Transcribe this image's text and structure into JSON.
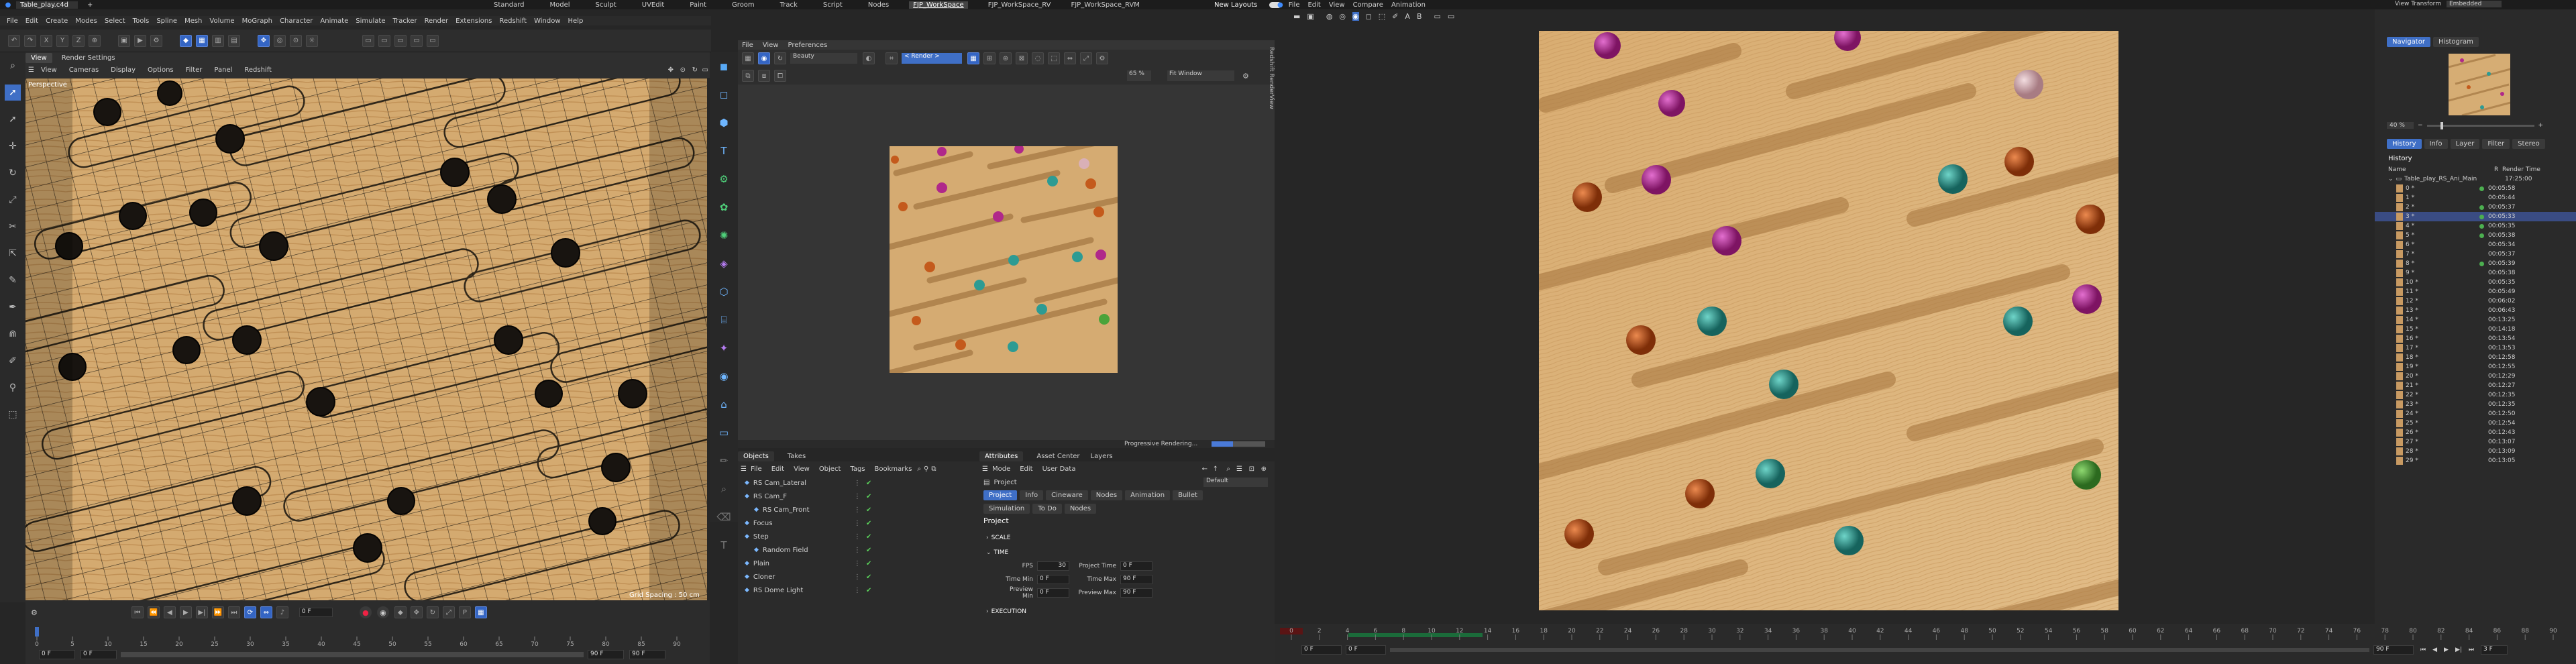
{
  "topbar": {
    "file": "Table_play.c4d",
    "layouts": [
      "Standard",
      "Model",
      "Sculpt",
      "UVEdit",
      "Paint",
      "Groom",
      "Track",
      "Script",
      "Nodes",
      "FJP_WorkSpace",
      "FJP_WorkSpace_RV",
      "FJP_WorkSpace_RVM"
    ],
    "active_layout": "FJP_WorkSpace",
    "new_layouts": "New Layouts",
    "rv_menu": [
      "File",
      "Edit",
      "View",
      "Compare",
      "Animation"
    ],
    "view_transform_label": "View Transform",
    "view_transform_value": "Embedded"
  },
  "menubar": [
    "File",
    "Edit",
    "Create",
    "Modes",
    "Select",
    "Tools",
    "Spline",
    "Mesh",
    "Volume",
    "MoGraph",
    "Character",
    "Animate",
    "Simulate",
    "Tracker",
    "Render",
    "Extensions",
    "Redshift",
    "Window",
    "Help"
  ],
  "viewport": {
    "tabs": [
      "View",
      "Render Settings"
    ],
    "menu": [
      "View",
      "Cameras",
      "Display",
      "Options",
      "Filter",
      "Panel",
      "Redshift"
    ],
    "label": "Perspective",
    "grid_spacing": "Grid Spacing : 50 cm"
  },
  "timeline": {
    "ticks": [
      "0",
      "5",
      "10",
      "15",
      "20",
      "25",
      "30",
      "35",
      "40",
      "45",
      "50",
      "55",
      "60",
      "65",
      "70",
      "75",
      "80",
      "85",
      "90"
    ],
    "current_frame": "0 F",
    "start": "0 F",
    "start2": "0 F",
    "end": "90 F",
    "end2": "90 F"
  },
  "rv": {
    "menu": [
      "File",
      "View",
      "Preferences"
    ],
    "beauty": "Beauty",
    "render_btn": "< Render >",
    "zoom": "65 %",
    "fit": "Fit Window",
    "progress_label": "Progressive Rendering...",
    "side_label": "Redshift RenderView"
  },
  "objects": {
    "tabs": [
      "Objects",
      "Takes"
    ],
    "menu": [
      "File",
      "Edit",
      "View",
      "Object",
      "Tags",
      "Bookmarks"
    ],
    "items": [
      {
        "name": "RS Cam_Lateral",
        "indent": 0
      },
      {
        "name": "RS Cam_F",
        "indent": 0
      },
      {
        "name": "RS Cam_Front",
        "indent": 1
      },
      {
        "name": "Focus",
        "indent": 0
      },
      {
        "name": "Step",
        "indent": 0
      },
      {
        "name": "Random Field",
        "indent": 1
      },
      {
        "name": "Plain",
        "indent": 0
      },
      {
        "name": "Cloner",
        "indent": 0
      },
      {
        "name": "RS Dome Light",
        "indent": 0
      }
    ]
  },
  "attributes": {
    "tabs": [
      "Attributes",
      "Asset Center",
      "Layers"
    ],
    "menu": [
      "Mode",
      "Edit",
      "User Data"
    ],
    "project_label": "Project",
    "default": "Default",
    "subtabs": [
      "Project",
      "Info",
      "Cineware",
      "Nodes",
      "Animation",
      "Bullet",
      "Simulation",
      "To Do",
      "Nodes"
    ],
    "section": "Project",
    "scale": "SCALE",
    "time": "TIME",
    "fps_label": "FPS",
    "fps": "30",
    "project_time_label": "Project Time",
    "project_time": "0 F",
    "min_time_label": "Time Min",
    "min_time": "0 F",
    "max_time_label": "Time Max",
    "max_time": "90 F",
    "prev_min_label": "Preview Min",
    "prev_min": "0 F",
    "prev_max_label": "Preview Max",
    "prev_max": "90 F",
    "execution": "EXECUTION"
  },
  "pictureviewer": {
    "tabs": [
      "Navigator",
      "Histogram"
    ],
    "zoom": "40 %",
    "tabs2": [
      "History",
      "Info",
      "Layer",
      "Filter",
      "Stereo"
    ],
    "history_label": "History",
    "col_name": "Name",
    "col_r": "R",
    "col_time": "Render Time",
    "root": "Table_play_RS_Ani_Main",
    "root_time": "17:25:00",
    "rows": [
      {
        "n": "0 *",
        "t": "00:05:58",
        "g": true
      },
      {
        "n": "1 *",
        "t": "00:05:44",
        "g": false
      },
      {
        "n": "2 *",
        "t": "00:05:37",
        "g": true
      },
      {
        "n": "3 *",
        "t": "00:05:33",
        "g": true,
        "sel": true
      },
      {
        "n": "4 *",
        "t": "00:05:35",
        "g": true
      },
      {
        "n": "5 *",
        "t": "00:05:38",
        "g": true
      },
      {
        "n": "6 *",
        "t": "00:05:34",
        "g": false
      },
      {
        "n": "7 *",
        "t": "00:05:37",
        "g": false
      },
      {
        "n": "8 *",
        "t": "00:05:39",
        "g": true
      },
      {
        "n": "9 *",
        "t": "00:05:38",
        "g": false
      },
      {
        "n": "10 *",
        "t": "00:05:35",
        "g": false
      },
      {
        "n": "11 *",
        "t": "00:05:49",
        "g": false
      },
      {
        "n": "12 *",
        "t": "00:06:02",
        "g": false
      },
      {
        "n": "13 *",
        "t": "00:06:43",
        "g": false
      },
      {
        "n": "14 *",
        "t": "00:13:25",
        "g": false
      },
      {
        "n": "15 *",
        "t": "00:14:18",
        "g": false
      },
      {
        "n": "16 *",
        "t": "00:13:54",
        "g": false
      },
      {
        "n": "17 *",
        "t": "00:13:53",
        "g": false
      },
      {
        "n": "18 *",
        "t": "00:12:58",
        "g": false
      },
      {
        "n": "19 *",
        "t": "00:12:55",
        "g": false
      },
      {
        "n": "20 *",
        "t": "00:12:29",
        "g": false
      },
      {
        "n": "21 *",
        "t": "00:12:27",
        "g": false
      },
      {
        "n": "22 *",
        "t": "00:12:35",
        "g": false
      },
      {
        "n": "23 *",
        "t": "00:12:35",
        "g": false
      },
      {
        "n": "24 *",
        "t": "00:12:50",
        "g": false
      },
      {
        "n": "25 *",
        "t": "00:12:54",
        "g": false
      },
      {
        "n": "26 *",
        "t": "00:12:43",
        "g": false
      },
      {
        "n": "27 *",
        "t": "00:13:07",
        "g": false
      },
      {
        "n": "28 *",
        "t": "00:13:09",
        "g": false
      },
      {
        "n": "29 *",
        "t": "00:13:05",
        "g": false
      }
    ]
  },
  "pv_timeline": {
    "ticks": [
      "0",
      "2",
      "4",
      "6",
      "8",
      "10",
      "12",
      "14",
      "16",
      "18",
      "20",
      "22",
      "24",
      "26",
      "28",
      "30",
      "32",
      "34",
      "36",
      "38",
      "40",
      "42",
      "44",
      "46",
      "48",
      "50",
      "52",
      "54",
      "56",
      "58",
      "60",
      "62",
      "64",
      "66",
      "68",
      "70",
      "72",
      "74",
      "76",
      "78",
      "80",
      "82",
      "84",
      "86",
      "88",
      "90"
    ],
    "current": "30",
    "start": "0 F",
    "start2": "0 F",
    "end": "90 F",
    "frame": "3 F"
  },
  "colors": {
    "accent": "#3f6fc6",
    "wood": "#d9b07a",
    "magenta": "#b0288a",
    "teal": "#2d9b93",
    "orange": "#c45a1c",
    "green": "#4aa33a",
    "pink": "#d9b0b7"
  }
}
